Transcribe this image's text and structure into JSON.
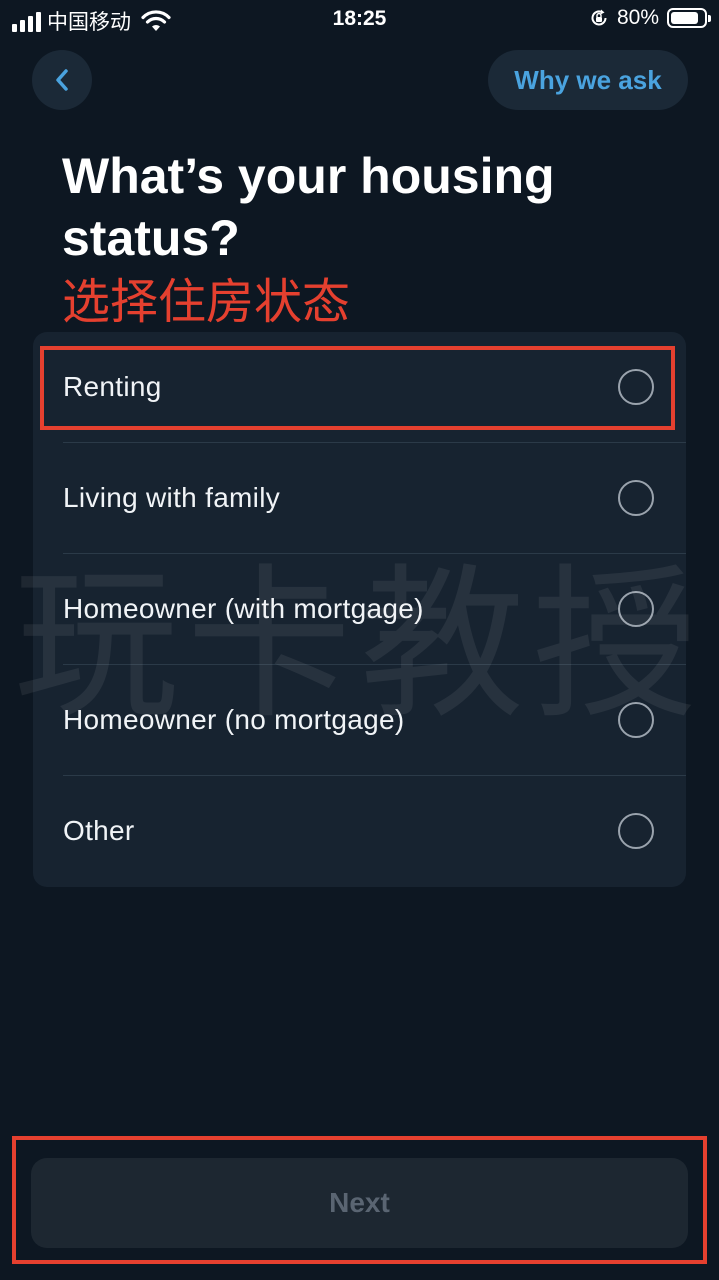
{
  "status_bar": {
    "carrier": "中国移动",
    "time": "18:25",
    "battery_percent": "80%",
    "battery_level": 0.8
  },
  "nav": {
    "back_icon": "chevron-left-icon",
    "why_label": "Why we ask"
  },
  "heading": {
    "title": "What’s your housing status?",
    "subtitle": "选择住房状态"
  },
  "options": [
    {
      "label": "Renting",
      "selected": false
    },
    {
      "label": "Living with family",
      "selected": false
    },
    {
      "label": "Homeowner (with mortgage)",
      "selected": false
    },
    {
      "label": "Homeowner (no mortgage)",
      "selected": false
    },
    {
      "label": "Other",
      "selected": false
    }
  ],
  "watermark": "玩卡教授",
  "footer": {
    "next_label": "Next"
  },
  "colors": {
    "background": "#0d1722",
    "card": "#172330",
    "accent_link": "#4aa3df",
    "annotation_red": "#e5402f"
  }
}
